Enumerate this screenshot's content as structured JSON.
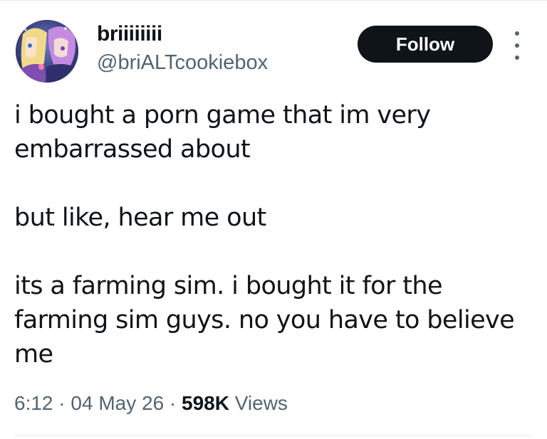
{
  "author": {
    "display_name": "briiiiiiii",
    "handle": "@briALTcookiebox",
    "avatar_icon": "anime-avatar-icon"
  },
  "actions": {
    "follow_label": "Follow",
    "more_icon": "more-options-icon"
  },
  "tweet": {
    "paragraphs": [
      "i bought a porn game that im very embarrassed about",
      "but like, hear me out",
      "its a farming sim. i bought it for the farming sim guys. no you have to believe me"
    ]
  },
  "meta": {
    "time": "6:12",
    "sep1": "·",
    "date": "04 May 26",
    "sep2": "·",
    "views_count": "598K",
    "views_label": "Views"
  },
  "colors": {
    "text_primary": "#0f1419",
    "text_secondary": "#536471",
    "button_bg": "#0f1419",
    "divider": "#e7e9ea"
  }
}
